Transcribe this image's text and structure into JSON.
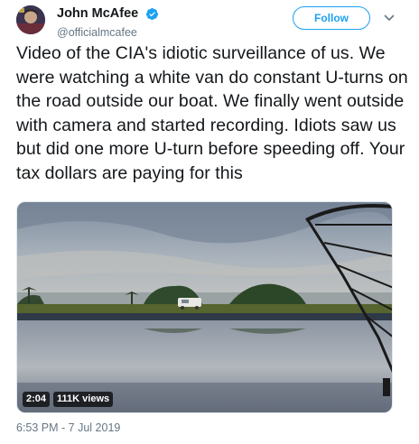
{
  "author": {
    "display_name": "John McAfee",
    "handle": "@officialmcafee",
    "verified": true
  },
  "actions": {
    "follow_label": "Follow",
    "more_icon": "chevron-down-icon"
  },
  "tweet": {
    "text": "Video of the CIA's idiotic surveillance of us. We were watching a white van do constant U-turns on the road outside our boat. We finally went outside with camera and started recording. Idiots saw us but did one more U-turn before speeding off. Your tax dollars are paying for this",
    "timestamp": "6:53 PM - 7 Jul 2019"
  },
  "media": {
    "type": "video",
    "duration": "2:04",
    "views": "111K views"
  },
  "colors": {
    "accent": "#1da1f2",
    "text": "#14171a",
    "secondary": "#657786"
  }
}
